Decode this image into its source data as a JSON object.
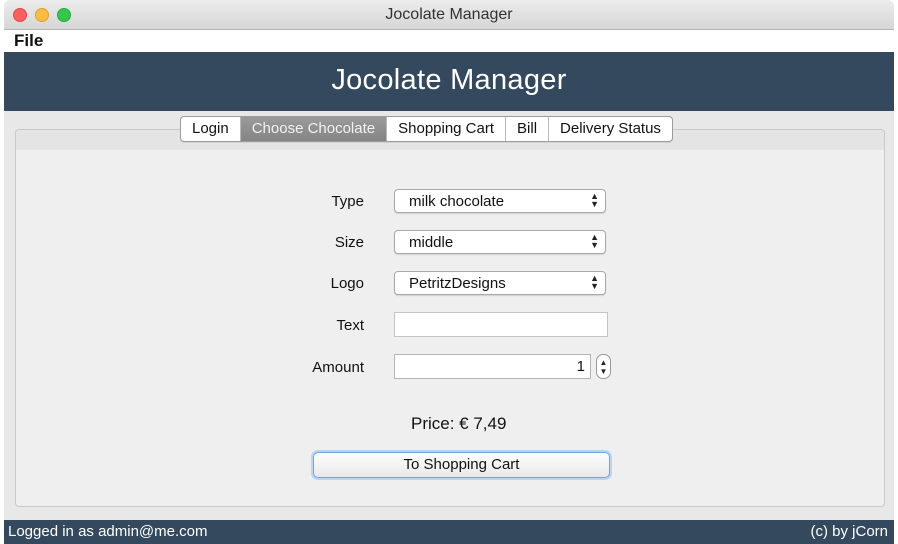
{
  "window": {
    "title": "Jocolate Manager"
  },
  "menu": {
    "file_label": "File"
  },
  "header": {
    "title": "Jocolate Manager",
    "background": "#34495e"
  },
  "tabs": [
    {
      "label": "Login",
      "active": false
    },
    {
      "label": "Choose Chocolate",
      "active": true
    },
    {
      "label": "Shopping Cart",
      "active": false
    },
    {
      "label": "Bill",
      "active": false
    },
    {
      "label": "Delivery Status",
      "active": false
    }
  ],
  "form": {
    "type": {
      "label": "Type",
      "value": "milk chocolate"
    },
    "size": {
      "label": "Size",
      "value": "middle"
    },
    "logo": {
      "label": "Logo",
      "value": "PetritzDesigns"
    },
    "text": {
      "label": "Text",
      "value": ""
    },
    "amount": {
      "label": "Amount",
      "value": "1"
    },
    "price_text": "Price: € 7,49",
    "button_label": "To Shopping Cart"
  },
  "status": {
    "left": "Logged in as admin@me.com",
    "right": "(c) by jCorn"
  },
  "icons": {
    "close": "close-dot-icon",
    "minimize": "minimize-dot-icon",
    "maximize": "maximize-dot-icon",
    "select_arrows": "updown-chevron-icon",
    "stepper": "stepper-arrows-icon"
  }
}
